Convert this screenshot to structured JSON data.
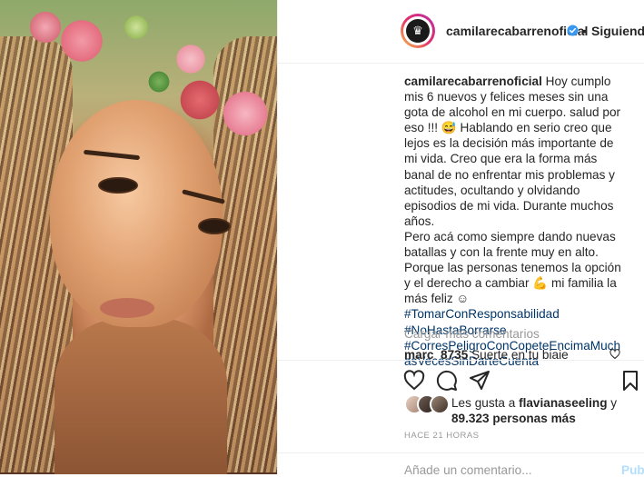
{
  "header": {
    "username": "camilarecabarrenoficial",
    "separator": "•",
    "follow_status": "Siguiendo"
  },
  "caption": {
    "username": "camilarecabarrenoficial",
    "line1": " Hoy cumplo mis 6 nuevos y felices meses sin una gota de alcohol en mi cuerpo. salud por eso !!! 😅 Hablando en serio creo que lejos es la decisión más importante de mi vida. Creo que era la forma más banal de no enfrentar mis problemas y actitudes, ocultando y olvidando episodios de mi vida. Durante muchos años.",
    "line2": "Pero acá como siempre dando nuevas batallas y con la frente muy en alto. Porque las personas tenemos la opción y el derecho a cambiar 💪 mi familia la más feliz ☺ ",
    "hashtag1": "#TomarConResponsabilidad",
    "hashtag2": "#NoHastaBorrarse",
    "hashtag3": "#CorresPeligroConCopeteEncimaMuchasVecesSinDarteCuenta"
  },
  "comments": {
    "load_more": "Cargar más comentarios",
    "first_user": "marc_8735",
    "first_text": " Suerte en tu biaje"
  },
  "likes": {
    "prefix": "Les gusta a ",
    "user": "flavianaseeling",
    "middle": " y ",
    "count": "89.323 personas más"
  },
  "timestamp": "HACE 21 HORAS",
  "add_comment": {
    "placeholder": "Añade un comentario...",
    "publish": "Publicar"
  },
  "icons": {
    "verified": "verified-badge-icon",
    "like": "heart-icon",
    "comment": "comment-bubble-icon",
    "share": "share-plane-icon",
    "save": "bookmark-icon"
  },
  "colors": {
    "link": "#003569",
    "verified": "#3897f0",
    "muted": "#999999",
    "publish_disabled": "#b2dffc"
  }
}
